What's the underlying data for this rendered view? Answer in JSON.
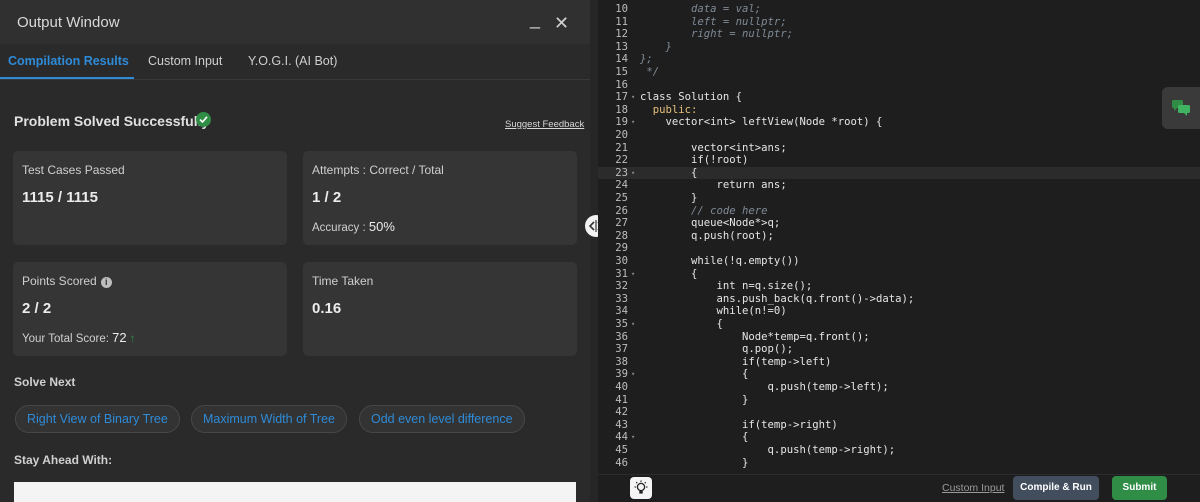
{
  "output_window": {
    "title": "Output Window",
    "minimize_glyph": "_",
    "close_glyph": "✕",
    "tabs": [
      {
        "label": "Compilation Results",
        "active": true
      },
      {
        "label": "Custom Input",
        "active": false
      },
      {
        "label": "Y.O.G.I. (AI Bot)",
        "active": false
      }
    ],
    "status": "Problem Solved Successfully",
    "suggest_feedback": "Suggest Feedback",
    "cards": {
      "test_cases": {
        "label": "Test Cases Passed",
        "value": "1115 / 1115"
      },
      "attempts": {
        "label": "Attempts : Correct / Total",
        "value": "1 / 2",
        "accuracy_label": "Accuracy :",
        "accuracy_value": "50%"
      },
      "points": {
        "label": "Points Scored",
        "value": "2 / 2",
        "total_label": "Your Total Score:",
        "total_value": "72"
      },
      "time": {
        "label": "Time Taken",
        "value": "0.16"
      }
    },
    "solve_next_title": "Solve Next",
    "solve_next": [
      "Right View of Binary Tree",
      "Maximum Width of Tree",
      "Odd even level difference"
    ],
    "stay_ahead_title": "Stay Ahead With:"
  },
  "colors": {
    "accent_blue": "#2e8bd8",
    "success_green": "#2f8d46",
    "run_button": "#424e5e"
  },
  "editor": {
    "lines": [
      {
        "n": "10",
        "text": "        data = val;",
        "cls": "c"
      },
      {
        "n": "11",
        "text": "        left = nullptr;",
        "cls": "c"
      },
      {
        "n": "12",
        "text": "        right = nullptr;",
        "cls": "c"
      },
      {
        "n": "13",
        "text": "    }",
        "cls": "c"
      },
      {
        "n": "14",
        "text": "};",
        "cls": "c"
      },
      {
        "n": "15",
        "text": " */",
        "cls": "c"
      },
      {
        "n": "16",
        "text": ""
      },
      {
        "n": "17",
        "text": "class Solution {",
        "fold": true
      },
      {
        "n": "18",
        "text": "  public:",
        "cls": "k"
      },
      {
        "n": "19",
        "text": "    vector<int> leftView(Node *root) {",
        "fold": true
      },
      {
        "n": "20",
        "text": ""
      },
      {
        "n": "21",
        "text": "        vector<int>ans;"
      },
      {
        "n": "22",
        "text": "        if(!root)"
      },
      {
        "n": "23",
        "text": "        {",
        "fold": true,
        "highlight": true
      },
      {
        "n": "24",
        "text": "            return ans;"
      },
      {
        "n": "25",
        "text": "        }"
      },
      {
        "n": "26",
        "text": "        // code here",
        "cls": "c"
      },
      {
        "n": "27",
        "text": "        queue<Node*>q;"
      },
      {
        "n": "28",
        "text": "        q.push(root);"
      },
      {
        "n": "29",
        "text": ""
      },
      {
        "n": "30",
        "text": "        while(!q.empty())"
      },
      {
        "n": "31",
        "text": "        {",
        "fold": true
      },
      {
        "n": "32",
        "text": "            int n=q.size();"
      },
      {
        "n": "33",
        "text": "            ans.push_back(q.front()->data);"
      },
      {
        "n": "34",
        "text": "            while(n!=0)"
      },
      {
        "n": "35",
        "text": "            {",
        "fold": true
      },
      {
        "n": "36",
        "text": "                Node*temp=q.front();"
      },
      {
        "n": "37",
        "text": "                q.pop();"
      },
      {
        "n": "38",
        "text": "                if(temp->left)"
      },
      {
        "n": "39",
        "text": "                {",
        "fold": true
      },
      {
        "n": "40",
        "text": "                    q.push(temp->left);"
      },
      {
        "n": "41",
        "text": "                }"
      },
      {
        "n": "42",
        "text": ""
      },
      {
        "n": "43",
        "text": "                if(temp->right)"
      },
      {
        "n": "44",
        "text": "                {",
        "fold": true
      },
      {
        "n": "45",
        "text": "                    q.push(temp->right);"
      },
      {
        "n": "46",
        "text": "                }"
      }
    ]
  },
  "footer": {
    "custom_input": "Custom Input",
    "compile_run": "Compile & Run",
    "submit": "Submit"
  }
}
